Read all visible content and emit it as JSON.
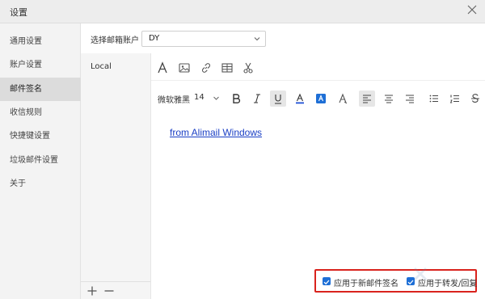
{
  "window": {
    "title": "设置",
    "close_icon": "close-icon"
  },
  "sidebar": {
    "items": [
      {
        "label": "通用设置",
        "active": false
      },
      {
        "label": "账户设置",
        "active": false
      },
      {
        "label": "邮件签名",
        "active": true
      },
      {
        "label": "收信规则",
        "active": false
      },
      {
        "label": "快捷键设置",
        "active": false
      },
      {
        "label": "垃圾邮件设置",
        "active": false
      },
      {
        "label": "关于",
        "active": false
      }
    ]
  },
  "account": {
    "label": "选择邮箱账户",
    "selected": "DY"
  },
  "signatures": {
    "items": [
      "Local"
    ],
    "add_icon": "plus-icon",
    "remove_icon": "minus-icon"
  },
  "toolbar": {
    "row1_icons": [
      "text-icon",
      "image-icon",
      "link-icon",
      "table-icon",
      "scissors-icon"
    ],
    "font_name": "微软雅黑",
    "font_size": "14",
    "row2_icons": [
      "bold-icon",
      "italic-icon",
      "underline-icon",
      "font-color-icon",
      "highlight-icon",
      "clear-format-icon",
      "align-left-icon",
      "align-center-icon",
      "align-right-icon",
      "bullet-list-icon",
      "numbered-list-icon",
      "strikethrough-icon"
    ]
  },
  "editor": {
    "link_text": "from Alimail Windows"
  },
  "options": {
    "new_mail": {
      "label": "应用于新邮件签名",
      "checked": true
    },
    "reply_forward": {
      "label": "应用于转发/回复",
      "checked": true
    }
  },
  "colors": {
    "accent": "#1e6fd6",
    "highlight_box": "#d9231d",
    "link": "#1a3fc5"
  }
}
